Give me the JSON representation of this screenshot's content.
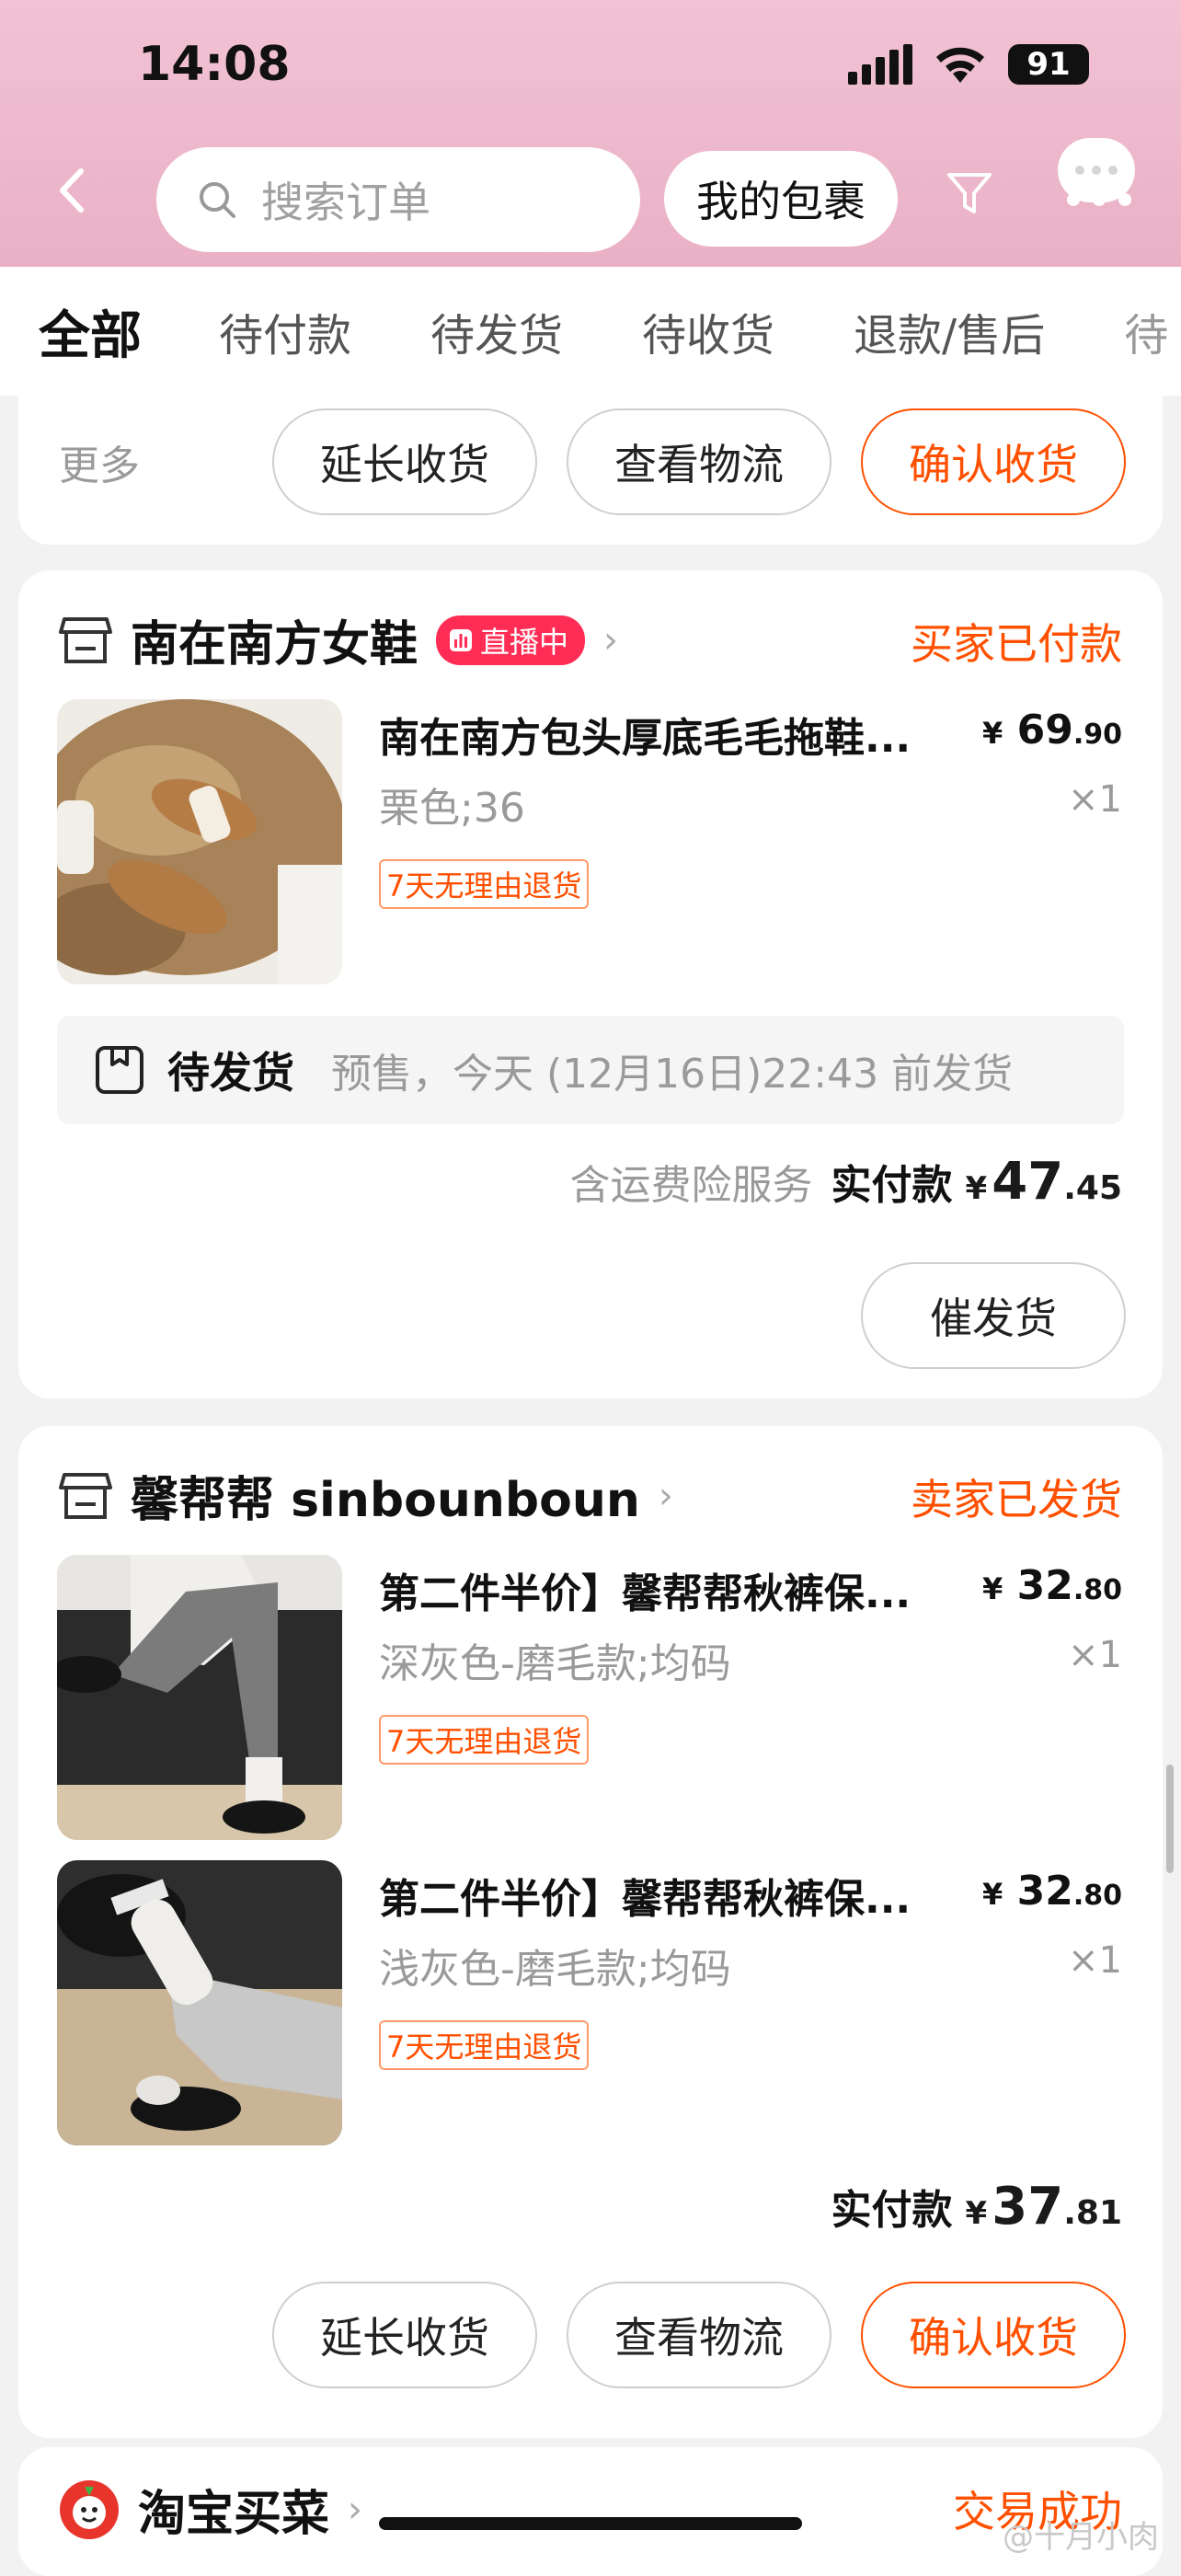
{
  "status_bar": {
    "time": "14:08",
    "battery": "91"
  },
  "header": {
    "search_placeholder": "搜索订单",
    "package_button": "我的包裹"
  },
  "tabs": [
    {
      "label": "全部",
      "active": true
    },
    {
      "label": "待付款"
    },
    {
      "label": "待发货"
    },
    {
      "label": "待收货"
    },
    {
      "label": "退款/售后"
    },
    {
      "label": "待"
    }
  ],
  "top_actions": {
    "more": "更多",
    "extend": "延长收货",
    "logistics": "查看物流",
    "confirm": "确认收货"
  },
  "orders": [
    {
      "shop": "南在南方女鞋",
      "live_badge": "直播中",
      "status": "买家已付款",
      "items": [
        {
          "title": "南在南方包头厚底毛毛拖鞋...",
          "spec": "栗色;36",
          "tag": "7天无理由退货",
          "price_yen": "¥",
          "price_int": "69",
          "price_dec": ".90",
          "qty": "×1"
        }
      ],
      "shipping_label": "待发货",
      "shipping_note": "预售，今天 (12月16日)22:43 前发货",
      "pay_note": "含运费险服务",
      "pay_label": "实付款",
      "pay_yen": "¥",
      "pay_int": "47",
      "pay_dec": ".45",
      "action": "催发货"
    },
    {
      "shop": "馨帮帮 sinbounboun",
      "status": "卖家已发货",
      "items": [
        {
          "title": "第二件半价】馨帮帮秋裤保...",
          "spec": "深灰色-磨毛款;均码",
          "tag": "7天无理由退货",
          "price_yen": "¥",
          "price_int": "32",
          "price_dec": ".80",
          "qty": "×1"
        },
        {
          "title": "第二件半价】馨帮帮秋裤保...",
          "spec": "浅灰色-磨毛款;均码",
          "tag": "7天无理由退货",
          "price_yen": "¥",
          "price_int": "32",
          "price_dec": ".80",
          "qty": "×1"
        }
      ],
      "pay_label": "实付款",
      "pay_yen": "¥",
      "pay_int": "37",
      "pay_dec": ".81",
      "actions": {
        "extend": "延长收货",
        "logistics": "查看物流",
        "confirm": "确认收货"
      }
    },
    {
      "shop": "淘宝买菜",
      "status": "交易成功"
    }
  ],
  "watermark": "@十月小肉",
  "colors": {
    "accent": "#ff5000",
    "header_pink": "#eeb6cb",
    "live": "#ff2d55"
  }
}
